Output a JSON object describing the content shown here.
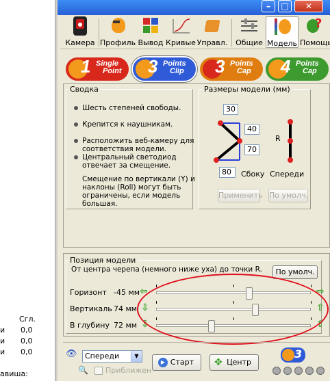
{
  "left": {
    "column_header": "Сгл.",
    "rows": [
      {
        "label": "и",
        "value": "0,0"
      },
      {
        "label": "и",
        "value": "0,0"
      },
      {
        "label": "и",
        "value": "0,0"
      }
    ],
    "bottom_label": "авиша:"
  },
  "titlebar": {
    "minimize": "–",
    "maximize": "□",
    "close": "✕"
  },
  "toolbar": [
    {
      "label": "Камера",
      "icon": "camera-icon"
    },
    {
      "label": "Профиль",
      "icon": "profile-icon"
    },
    {
      "label": "Вывод",
      "icon": "output-icon"
    },
    {
      "label": "Кривые",
      "icon": "curves-icon"
    },
    {
      "label": "Управл.",
      "icon": "control-icon"
    },
    {
      "label": "Общие",
      "icon": "general-icon"
    },
    {
      "label": "Модель",
      "icon": "model-icon"
    },
    {
      "label": "Помощь",
      "icon": "help-icon"
    }
  ],
  "modes": [
    {
      "num": "1",
      "line1": "Single",
      "line2": "Point",
      "color": "#d8281c"
    },
    {
      "num": "3",
      "line1": "Points",
      "line2": "Clip",
      "color": "#2f5bd9"
    },
    {
      "num": "3",
      "line1": "Points",
      "line2": "Cap",
      "color": "#e07d10"
    },
    {
      "num": "4",
      "line1": "Points",
      "line2": "Cap",
      "color": "#3d9a2e"
    }
  ],
  "summary": {
    "title": "Сводка",
    "items": [
      "Шесть степеней свободы.",
      "Крепится к наушникам.",
      "Расположить веб-камеру для соответствия модели.",
      "Центральный светодиод отвечает за смещение.",
      "Смещение по вертикали (Y) и наклоны (Roll) могут быть ограничены, если модель большая."
    ]
  },
  "dims": {
    "title": "Размеры модели (мм)",
    "top": "30",
    "mid_upper": "40",
    "mid_lower": "70",
    "bottom": "80",
    "side_label": "Сбоку",
    "front_label": "Спереди",
    "r_label": "R",
    "apply": "Применить",
    "default": "По умолч."
  },
  "position": {
    "title": "Позиция модели",
    "description": "От центра черепа (немного ниже уха) до точки R.",
    "default_button": "По умолч.",
    "sliders": [
      {
        "label": "Горизонт",
        "value": "-45 мм",
        "fraction": 0.6
      },
      {
        "label": "Вертикаль",
        "value": "74 мм",
        "fraction": 0.64
      },
      {
        "label": "В глубину",
        "value": "72 мм",
        "fraction": 0.36
      }
    ]
  },
  "bottom": {
    "view_select": "Спереди",
    "zoom_label": "Приближен",
    "start": "Старт",
    "center": "Центр"
  },
  "colors": {
    "accent": "#2760d6",
    "highlight": "#e0101c"
  }
}
